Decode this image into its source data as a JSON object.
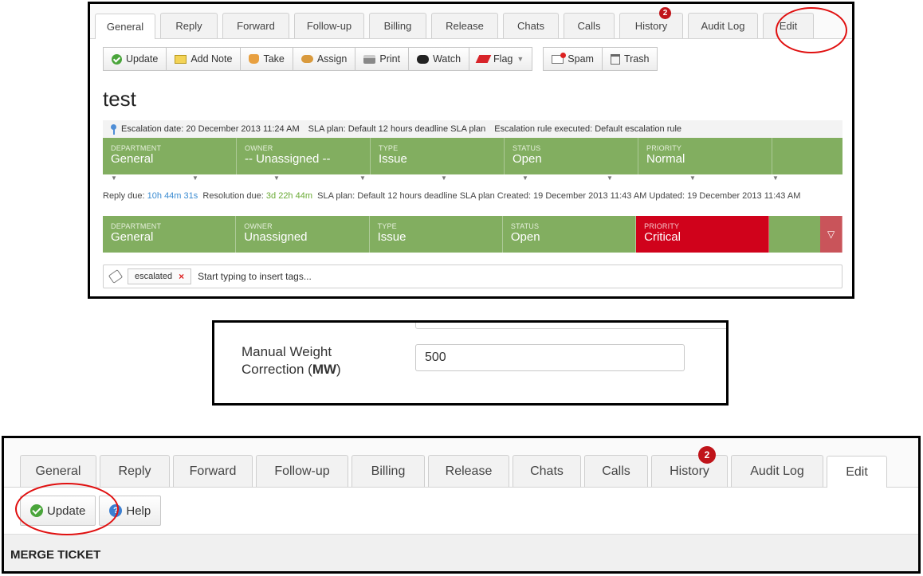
{
  "top_panel": {
    "tabs": [
      {
        "label": "General",
        "active": true
      },
      {
        "label": "Reply"
      },
      {
        "label": "Forward"
      },
      {
        "label": "Follow-up"
      },
      {
        "label": "Billing"
      },
      {
        "label": "Release"
      },
      {
        "label": "Chats"
      },
      {
        "label": "Calls"
      },
      {
        "label": "History",
        "badge": "2"
      },
      {
        "label": "Audit Log"
      },
      {
        "label": "Edit"
      }
    ],
    "toolbar": {
      "update": "Update",
      "add_note": "Add Note",
      "take": "Take",
      "assign": "Assign",
      "print": "Print",
      "watch": "Watch",
      "flag": "Flag",
      "spam": "Spam",
      "trash": "Trash"
    },
    "ticket_title": "test",
    "escalation": {
      "date": "Escalation date: 20 December 2013 11:24 AM",
      "sla": "SLA plan: Default 12 hours deadline SLA plan",
      "rule": "Escalation rule executed: Default escalation rule"
    },
    "row1": [
      {
        "k": "DEPARTMENT",
        "v": "General"
      },
      {
        "k": "OWNER",
        "v": "-- Unassigned --"
      },
      {
        "k": "TYPE",
        "v": "Issue"
      },
      {
        "k": "STATUS",
        "v": "Open"
      },
      {
        "k": "PRIORITY",
        "v": "Normal"
      }
    ],
    "due": {
      "reply_label": "Reply due:",
      "reply_value": "10h 44m 31s",
      "resolution_label": "Resolution due:",
      "resolution_value": "3d 22h 44m",
      "rest": "SLA plan: Default 12 hours deadline SLA plan   Created: 19 December 2013 11:43 AM   Updated: 19 December 2013 11:43 AM"
    },
    "row2": [
      {
        "k": "DEPARTMENT",
        "v": "General"
      },
      {
        "k": "OWNER",
        "v": "Unassigned"
      },
      {
        "k": "TYPE",
        "v": "Issue"
      },
      {
        "k": "STATUS",
        "v": "Open"
      },
      {
        "k": "PRIORITY",
        "v": "Critical"
      }
    ],
    "tags": {
      "chip": "escalated",
      "placeholder": "Start typing to insert tags..."
    }
  },
  "mid_panel": {
    "label_main": "Manual Weight",
    "label_second": "Correction (",
    "label_bold": "MW",
    "label_close": ")",
    "value": "500"
  },
  "bottom_panel": {
    "tabs": [
      {
        "label": "General"
      },
      {
        "label": "Reply"
      },
      {
        "label": "Forward"
      },
      {
        "label": "Follow-up"
      },
      {
        "label": "Billing"
      },
      {
        "label": "Release"
      },
      {
        "label": "Chats"
      },
      {
        "label": "Calls"
      },
      {
        "label": "History",
        "badge": "2"
      },
      {
        "label": "Audit Log"
      },
      {
        "label": "Edit",
        "active": true
      }
    ],
    "update": "Update",
    "help": "Help",
    "section": "MERGE TICKET"
  },
  "colors": {
    "status_green": "#82ae60",
    "critical_red": "#d0021b",
    "highlight_circle": "#e01010",
    "badge_red": "#c0141a"
  }
}
